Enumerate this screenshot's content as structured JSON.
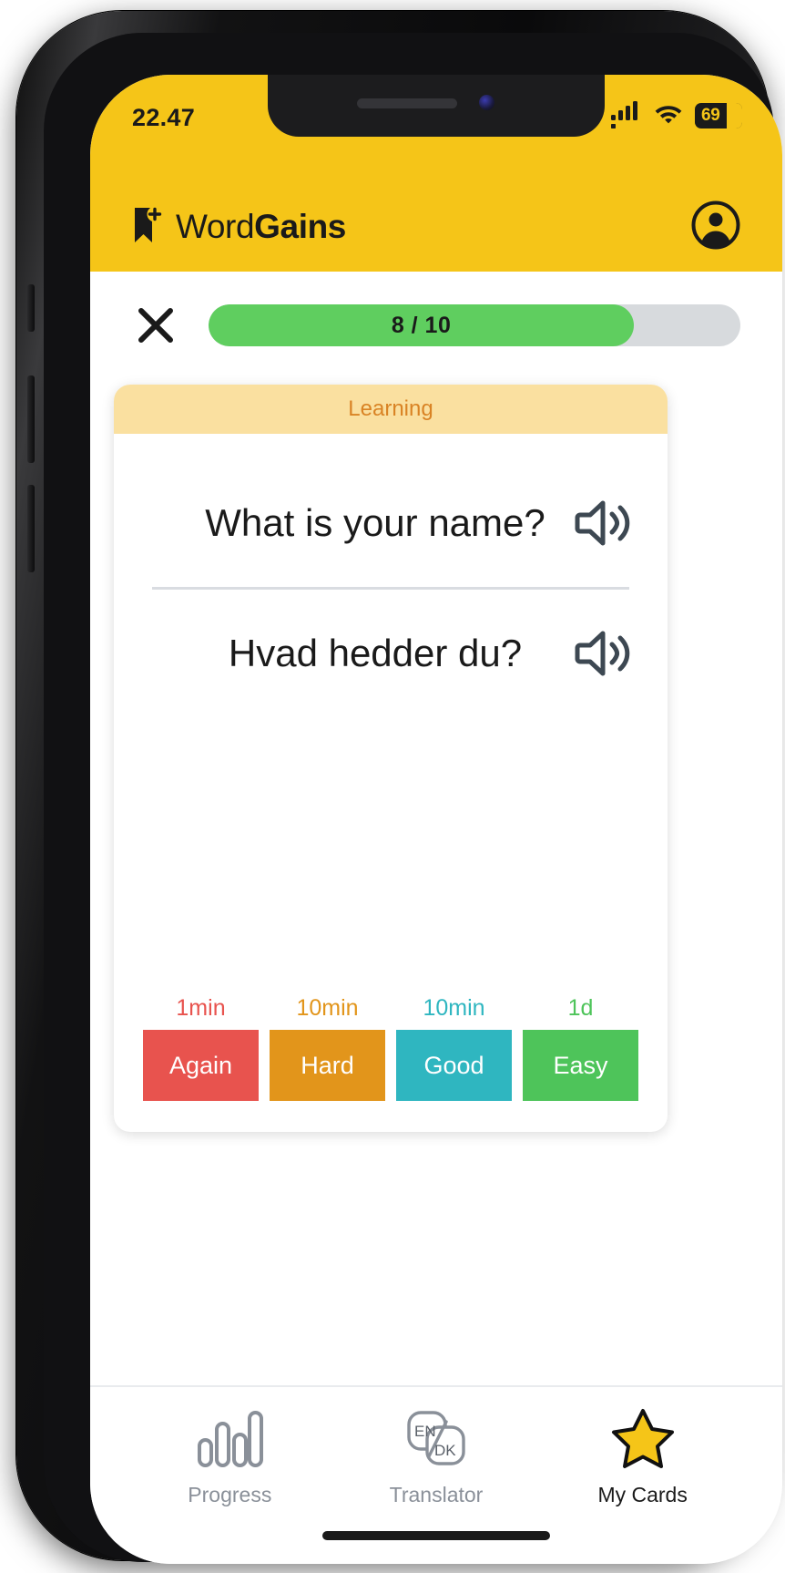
{
  "status_bar": {
    "time": "22.47",
    "signal_icon": "cellular-signal-icon",
    "wifi_icon": "wifi-icon",
    "battery_level": "69",
    "battery_icon": "battery-icon"
  },
  "header": {
    "logo_icon": "bookmark-plus-icon",
    "brand_light": "Word",
    "brand_bold": "Gains",
    "avatar_icon": "account-circle-icon",
    "background": "#F5C518"
  },
  "session": {
    "close_icon": "close-icon",
    "progress_label": "8 / 10",
    "progress_current": 8,
    "progress_total": 10,
    "progress_percent": 80,
    "fill_color": "#5fce5f",
    "track_color": "#d7dadd"
  },
  "card": {
    "status_label": "Learning",
    "status_bg": "#FAE0A0",
    "status_color": "#D98324",
    "front": {
      "text": "What is your name?",
      "speaker_icon": "speaker-volume-icon"
    },
    "back": {
      "text": "Hvad hedder du?",
      "speaker_icon": "speaker-volume-icon"
    }
  },
  "answers": [
    {
      "interval": "1min",
      "label": "Again",
      "color": "#E8534E",
      "name": "answer-again"
    },
    {
      "interval": "10min",
      "label": "Hard",
      "color": "#E2951B",
      "name": "answer-hard"
    },
    {
      "interval": "10min",
      "label": "Good",
      "color": "#2FB6C0",
      "name": "answer-good"
    },
    {
      "interval": "1d",
      "label": "Easy",
      "color": "#4EC45A",
      "name": "answer-easy"
    }
  ],
  "bottom_nav": [
    {
      "label": "Progress",
      "icon": "bar-chart-icon",
      "active": false
    },
    {
      "label": "Translator",
      "icon": "translate-icon",
      "active": false
    },
    {
      "label": "My Cards",
      "icon": "star-icon",
      "active": true
    }
  ],
  "translator_icon": {
    "source_lang": "EN",
    "target_lang": "DK"
  }
}
